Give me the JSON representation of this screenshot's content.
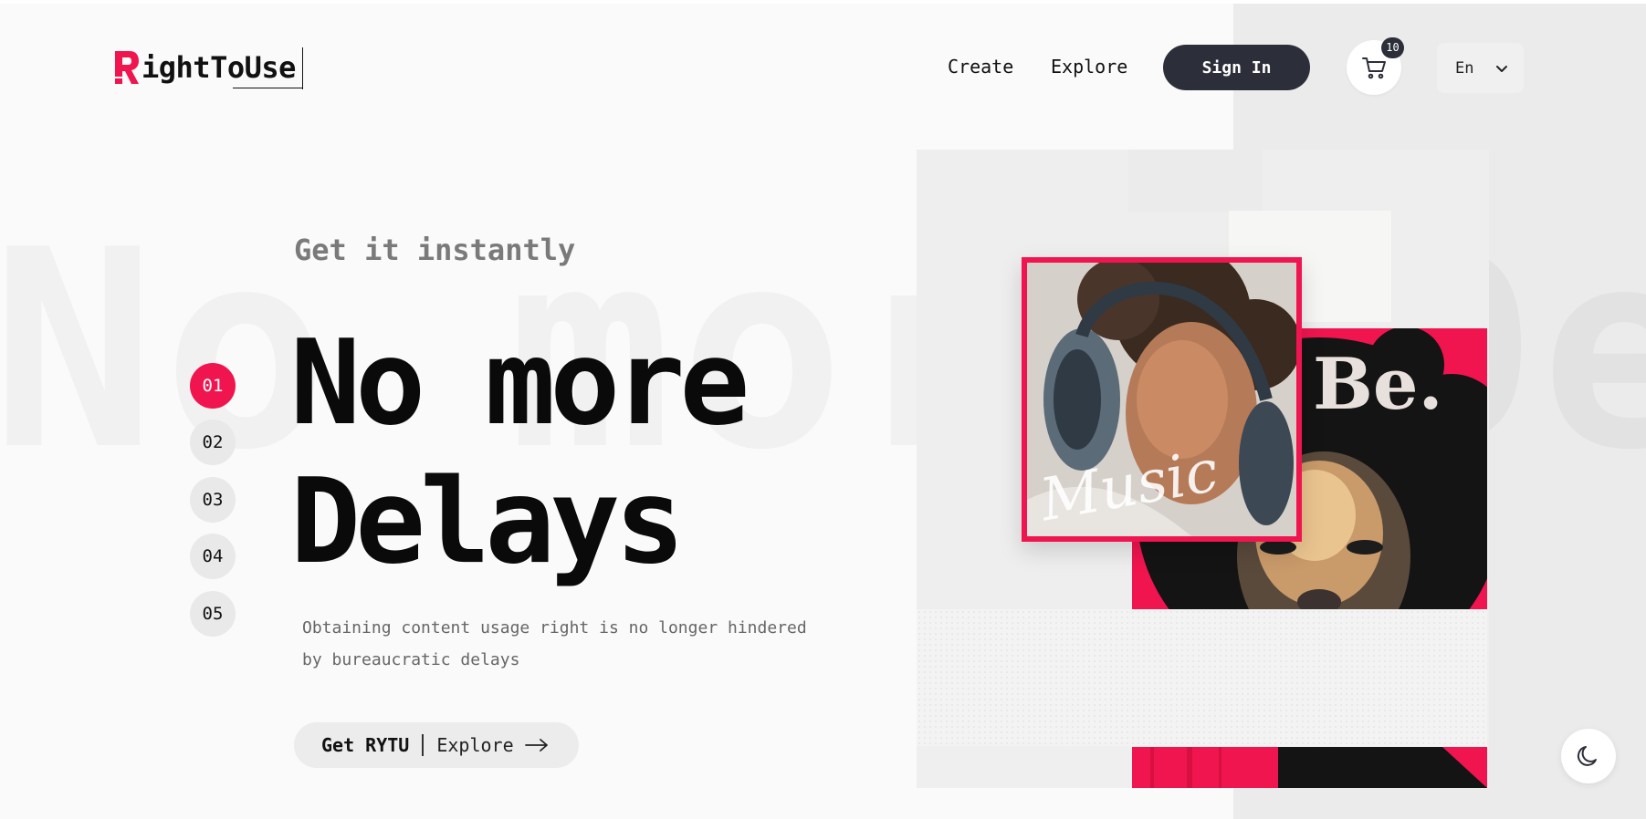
{
  "brand": {
    "logo_letter": "R",
    "logo_rest": "ightToUse",
    "accent_color": "#f0154f",
    "dark_color": "#2c2f39"
  },
  "nav": {
    "create_label": "Create",
    "explore_label": "Explore",
    "signin_label": "Sign In",
    "cart_count": "10",
    "language": "En"
  },
  "hero": {
    "watermark": "No more Delays",
    "eyebrow": "Get it instantly",
    "title_line1": "No more",
    "title_line2": "Delays",
    "description": "Obtaining content usage right is no longer hindered by bureaucratic delays",
    "cta_primary": "Get RYTU",
    "cta_secondary": "Explore"
  },
  "steps": [
    "01",
    "02",
    "03",
    "04",
    "05"
  ],
  "active_step": "01",
  "collage": {
    "card_be_text": "Be.",
    "card_music_text": "Music"
  },
  "icons": {
    "cart": "cart-icon",
    "chevron": "chevron-down-icon",
    "arrow": "arrow-right-icon",
    "theme": "moon-icon"
  }
}
